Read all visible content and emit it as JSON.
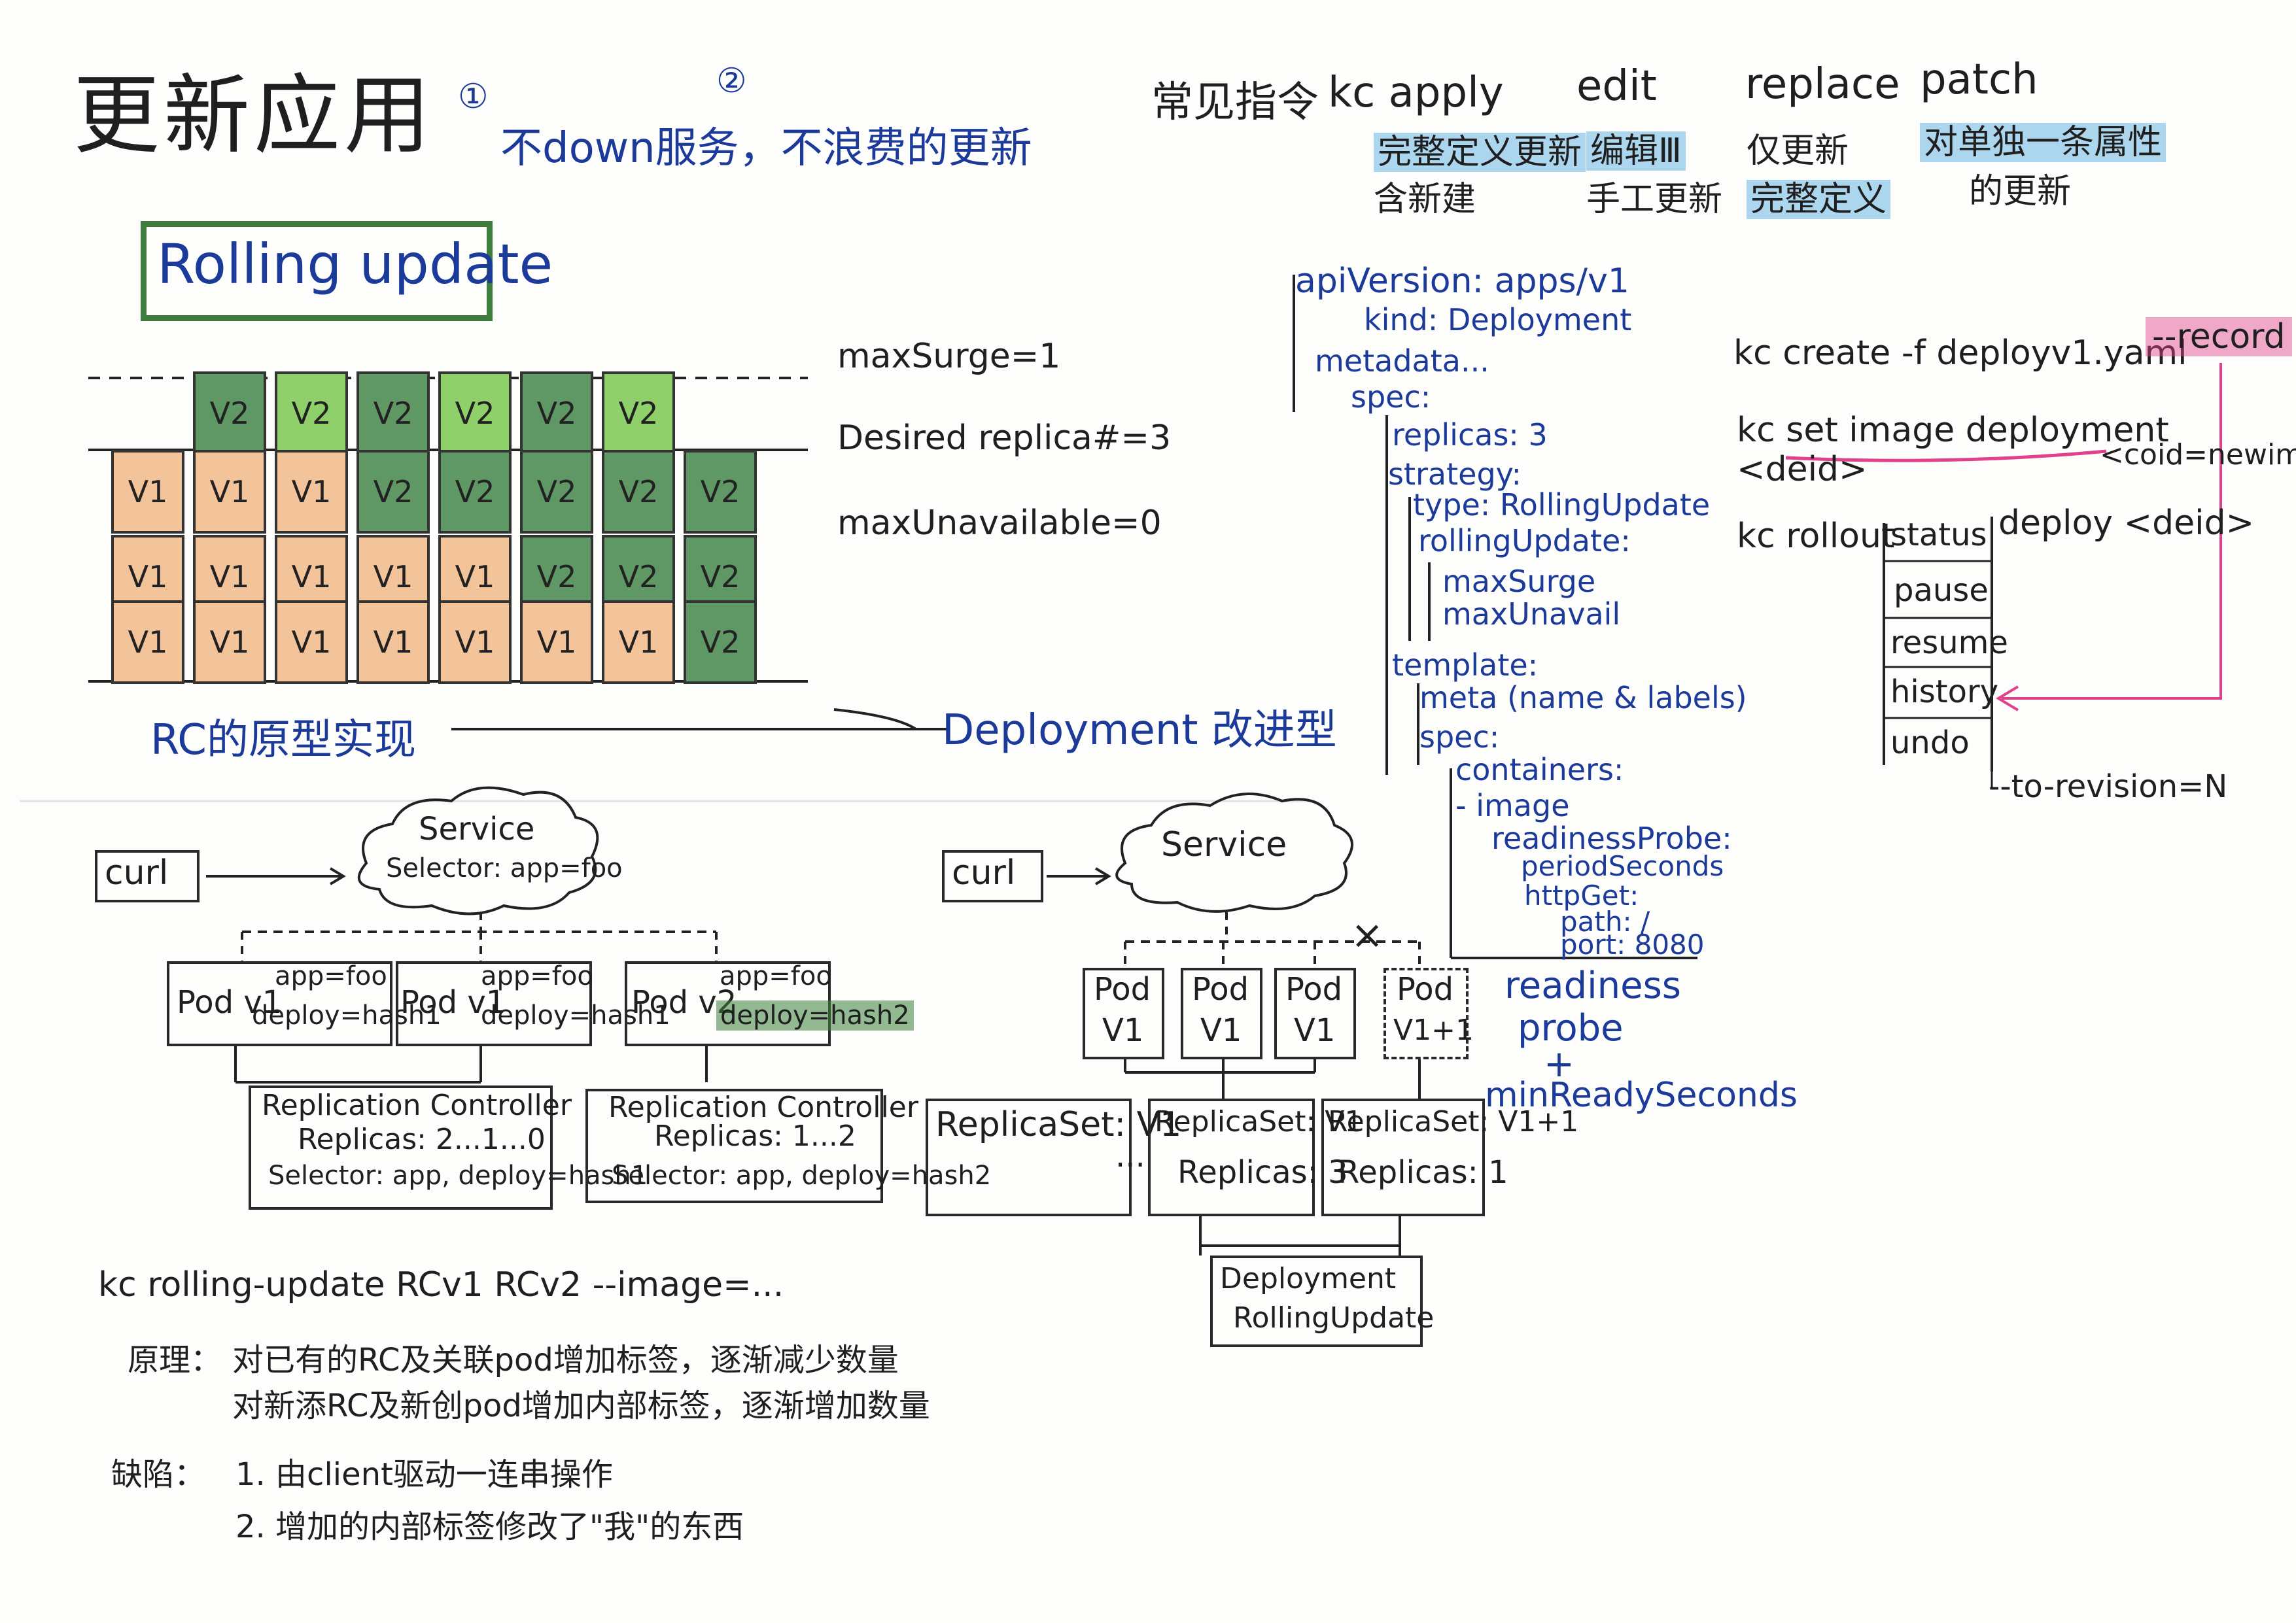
{
  "header": {
    "title": "更新应用",
    "marker_one": "①",
    "marker_two": "②",
    "goal": "不down服务，不浪费的更新",
    "subtitle": "Rolling update"
  },
  "commands": {
    "prefix": "常见指令",
    "apply": {
      "name": "kc apply",
      "desc1": "完整定义更新",
      "desc2": "含新建"
    },
    "edit": {
      "name": "edit",
      "desc1": "编辑Ⅲ",
      "desc2": "手工更新"
    },
    "replace": {
      "name": "replace",
      "desc1": "仅更新",
      "desc2": "完整定义"
    },
    "patch": {
      "name": "patch",
      "desc1": "对单独一条属性",
      "desc2": "的更新"
    }
  },
  "grid": {
    "label_max_surge": "maxSurge=1",
    "label_desired": "Desired replica#=3",
    "label_max_unavailable": "maxUnavailable=0",
    "v1": "V1",
    "v2": "V2",
    "columns": [
      [
        "V2",
        "V1",
        "V1",
        "V1"
      ],
      [
        "V2",
        "V1",
        "V1",
        "V1"
      ],
      [
        "V2",
        "V2",
        "V1",
        "V1"
      ],
      [
        "V2",
        "V2",
        "V1",
        "V1"
      ],
      [
        "V2",
        "V2",
        "V2",
        "V1"
      ],
      [
        "V2",
        "V2",
        "V2",
        "V1"
      ],
      [
        "V2",
        "V2",
        "V2"
      ]
    ],
    "lead_column": [
      "V1",
      "V1",
      "V1"
    ]
  },
  "arrow_row": {
    "left": "RC的原型实现",
    "right": "Deployment 改进型"
  },
  "yaml": {
    "lines": [
      "apiVersion: apps/v1",
      "kind: Deployment",
      "metadata...",
      "spec:",
      "replicas: 3",
      "strategy:",
      "type: RollingUpdate",
      "rollingUpdate:",
      "maxSurge",
      "maxUnavail",
      "template:",
      "meta (name & labels)",
      "spec:",
      "containers:",
      "- image",
      "readinessProbe:",
      "periodSeconds",
      "httpGet:",
      "path: /",
      "port: 8080"
    ],
    "readiness_note": [
      "readiness",
      "probe",
      "+",
      "minReadySeconds"
    ]
  },
  "cli": {
    "create": "kc create -f deployv1.yaml",
    "record": "--record",
    "set_image": "kc set image deployment <deid>",
    "set_image_arg": "<coid=newimag",
    "rollout_prefix": "kc rollout",
    "rollout_suffix": "deploy <deid>",
    "rollout_items": [
      "status",
      "pause",
      "resume",
      "history",
      "undo"
    ],
    "to_revision": "--to-revision=N"
  },
  "rc_diagram": {
    "curl": "curl",
    "service_line1": "Service",
    "service_line2": "Selector: app=foo",
    "pods": [
      {
        "name": "Pod v1",
        "label1": "app=foo",
        "label2": "deploy=hash1"
      },
      {
        "name": "Pod v1",
        "label1": "app=foo",
        "label2": "deploy=hash1"
      },
      {
        "name": "Pod v2",
        "label1": "app=foo",
        "label2": "deploy=hash2"
      }
    ],
    "rc1": {
      "title": "Replication Controller",
      "replicas": "Replicas: 2...1...0",
      "selector": "Selector: app, deploy=hash1"
    },
    "rc2": {
      "title": "Replication Controller",
      "replicas": "Replicas: 1...2",
      "selector": "Selector: app, deploy=hash2"
    }
  },
  "deploy_diagram": {
    "curl": "curl",
    "service": "Service",
    "x_mark": "×",
    "pods": [
      {
        "top": "Pod",
        "bottom": "V1"
      },
      {
        "top": "Pod",
        "bottom": "V1"
      },
      {
        "top": "Pod",
        "bottom": "V1"
      },
      {
        "top": "Pod",
        "bottom": "V1+1"
      }
    ],
    "rs1": "ReplicaSet: V1",
    "ellipsis": "...",
    "rs2_title": "ReplicaSet: V1",
    "rs2_replicas": "Replicas: 3",
    "rs3_title": "ReplicaSet: V1+1",
    "rs3_replicas": "Replicas: 1",
    "deployment_line1": "Deployment",
    "deployment_line2": "RollingUpdate"
  },
  "rolling_update_notes": {
    "command": "kc rolling-update RCv1 RCv2 --image=...",
    "principle_label": "原理：",
    "principle_1": "对已有的RC及关联pod增加标签，逐渐减少数量",
    "principle_2": "对新添RC及新创pod增加内部标签，逐渐增加数量",
    "defect_label": "缺陷：",
    "defect_1": "1. 由client驱动一连串操作",
    "defect_2": "2. 增加的内部标签修改了\"我\"的东西"
  },
  "colors": {
    "ink": "#222222",
    "blue_ink": "#1b3a9a",
    "v1_orange": "#f3c39a",
    "v2_green_dark": "#5f9865",
    "v2_green_light": "#8fd06b",
    "pink_highlight": "#e0408c",
    "blue_highlight": "#4aa6de",
    "frame_green": "#3f7d3f"
  }
}
